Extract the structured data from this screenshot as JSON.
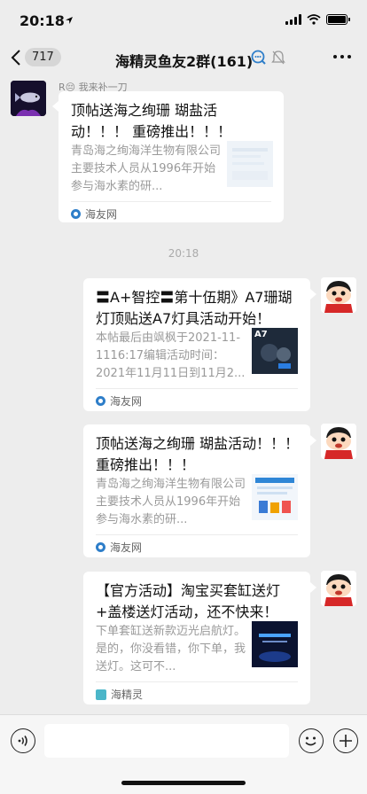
{
  "status_bar": {
    "time": "20:18"
  },
  "nav": {
    "back_count": "717",
    "title": "海精灵鱼友2群(161)"
  },
  "messages": [
    {
      "sender": "R😔 我来补一刀",
      "title": "顶帖送海之绚珊 瑚盐活动！！！ 重磅推出！！！",
      "desc": "青岛海之绚海洋生物有限公司主要技术人员从1996年开始参与海水素的研...",
      "source": "海友网"
    },
    {
      "time": "20:18"
    },
    {
      "title": "〓A+智控〓第十伍期》A7珊瑚灯顶贴送A7灯具活动开始！",
      "desc": "本帖最后由飒枫于2021-11-1116:17编辑活动时间：2021年11月11日到11月2...",
      "source": "海友网",
      "thumb_text": "A7"
    },
    {
      "title": "顶帖送海之绚珊 瑚盐活动！！！ 重磅推出！！！",
      "desc": "青岛海之绚海洋生物有限公司主要技术人员从1996年开始参与海水素的研...",
      "source": "海友网"
    },
    {
      "title": "【官方活动】淘宝买套缸送灯+盖楼送灯活动，还不快来！",
      "desc": "下单套缸送新款迈光启航灯。是的，你没看错，你下单，我送灯。这可不...",
      "source": "海精灵"
    }
  ],
  "colors": {
    "background": "#ededed",
    "card": "#ffffff",
    "link_blue": "#2e7ec9"
  }
}
